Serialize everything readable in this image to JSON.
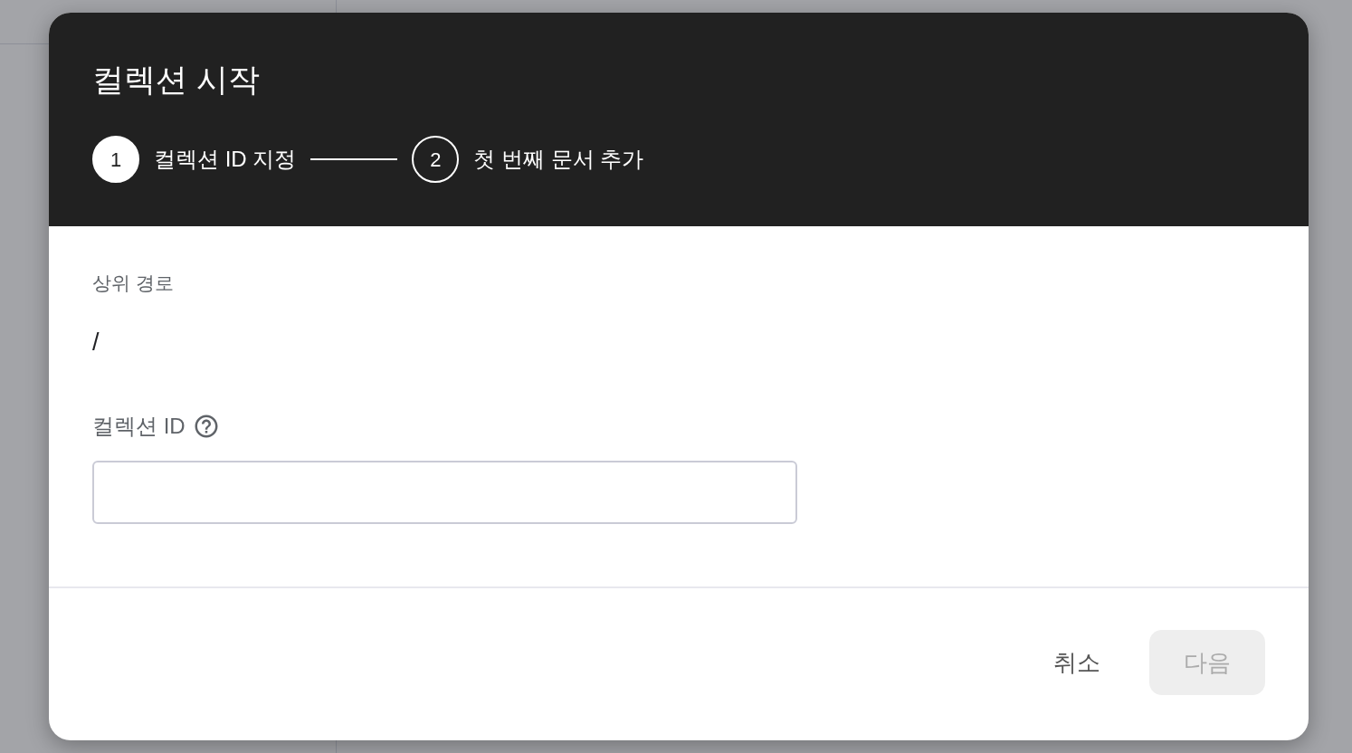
{
  "dialog": {
    "title": "컬렉션 시작",
    "steps": [
      {
        "number": "1",
        "label": "컬렉션 ID 지정",
        "selected": true
      },
      {
        "number": "2",
        "label": "첫 번째 문서 추가",
        "selected": false
      }
    ]
  },
  "parent_path": {
    "label": "상위 경로",
    "value": "/"
  },
  "collection_id": {
    "label": "컬렉션 ID"
  },
  "buttons": [
    {
      "label": "취소",
      "kind": "text",
      "disabled": false
    },
    {
      "label": "다음",
      "kind": "filled",
      "disabled": true
    }
  ]
}
